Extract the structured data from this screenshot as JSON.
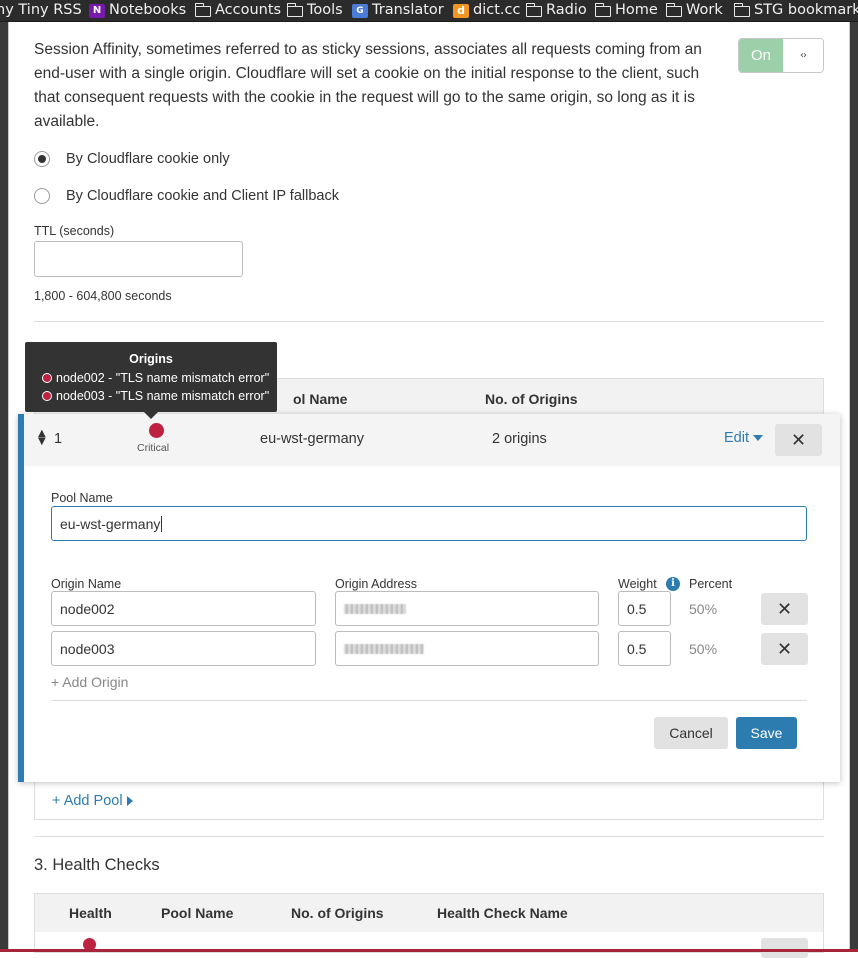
{
  "bookmarks": [
    {
      "label": "ny Tiny RSS",
      "icon": "none"
    },
    {
      "label": "Notebooks",
      "icon": "onenote-icon"
    },
    {
      "label": "Accounts",
      "icon": "folder-icon"
    },
    {
      "label": "Tools",
      "icon": "folder-icon"
    },
    {
      "label": "Translator",
      "icon": "translator-icon"
    },
    {
      "label": "dict.cc",
      "icon": "dictcc-icon"
    },
    {
      "label": "Radio",
      "icon": "folder-icon"
    },
    {
      "label": "Home",
      "icon": "folder-icon"
    },
    {
      "label": "Work",
      "icon": "folder-icon"
    },
    {
      "label": "STG bookmarks",
      "icon": "folder-icon"
    }
  ],
  "affinity": {
    "description": "Session Affinity, sometimes referred to as sticky sessions, associates all requests coming from an end-user with a single origin. Cloudflare will set a cookie on the initial response to the client, such that consequent requests with the cookie in the request will go to the same origin, so long as it is available.",
    "toggle_label": "On",
    "toggle_handle": "‹›",
    "options": [
      "By Cloudflare cookie only",
      "By Cloudflare cookie and Client IP fallback"
    ],
    "selected_option": 0,
    "ttl_label": "TTL (seconds)",
    "ttl_value": "",
    "ttl_hint": "1,800 - 604,800 seconds"
  },
  "tooltip": {
    "title": "Origins",
    "items": [
      "node002 - \"TLS name mismatch error\"",
      "node003 - \"TLS name mismatch error\""
    ]
  },
  "pools_table": {
    "headers": [
      "ol Name",
      "No. of Origins"
    ]
  },
  "pool_row": {
    "number": "1",
    "status": "Critical",
    "name": "eu-wst-germany",
    "origins": "2 origins",
    "edit_label": "Edit",
    "remove_symbol": "✕"
  },
  "pool_form": {
    "pool_name_label": "Pool Name",
    "pool_name_value": "eu-wst-germany",
    "col_origin_name": "Origin Name",
    "col_origin_address": "Origin Address",
    "col_weight": "Weight",
    "col_percent": "Percent",
    "origins": [
      {
        "name": "node002",
        "weight": "0.5",
        "percent": "50%"
      },
      {
        "name": "node003",
        "weight": "0.5",
        "percent": "50%"
      }
    ],
    "add_origin": "+ Add Origin",
    "cancel_label": "Cancel",
    "save_label": "Save"
  },
  "add_pool": "+ Add Pool",
  "health_checks": {
    "title": "3. Health Checks",
    "headers": [
      "Health",
      "Pool Name",
      "No. of Origins",
      "Health Check Name"
    ]
  },
  "colors": {
    "accent": "#2c7cb0",
    "critical": "#bd2241",
    "toggle_on": "#9bd0a8"
  }
}
